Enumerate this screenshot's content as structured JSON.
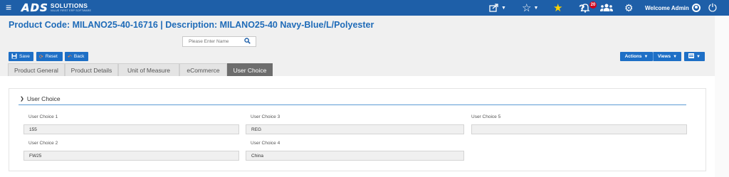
{
  "navbar": {
    "menu_icon": "hamburger-icon",
    "logo": {
      "primary": "ADS",
      "secondary": "SOLUTIONS",
      "tagline": "VALUE FIRST ERP SOFTWARE"
    },
    "icons": [
      "share-icon",
      "star-outline-icon",
      "star-filled-icon",
      "help-icon",
      "bell-icon",
      "users-icon",
      "gear-icon",
      "power-icon"
    ],
    "notification_count": "20",
    "welcome_text": "Welcome Admin",
    "accent_color": "#1e5fa8"
  },
  "page": {
    "title": "Product Code:  MILANO25-40-16716 | Description: MILANO25-40 Navy-Blue/L/Polyester"
  },
  "search": {
    "placeholder": "Please Enter Name"
  },
  "toolbar": {
    "save_label": "Save",
    "reset_label": "Reset",
    "back_label": "Back",
    "actions_label": "Actions",
    "views_label": "Views"
  },
  "tabs": [
    {
      "label": "Product General",
      "active": false
    },
    {
      "label": "Product Details",
      "active": false
    },
    {
      "label": "Unit of Measure",
      "active": false
    },
    {
      "label": "eCommerce",
      "active": false
    },
    {
      "label": "User Choice",
      "active": true
    }
  ],
  "section": {
    "title": "User Choice"
  },
  "fields": {
    "user_choice_1": {
      "label": "User Choice 1",
      "value": "155"
    },
    "user_choice_2": {
      "label": "User Choice 2",
      "value": "FW25"
    },
    "user_choice_3": {
      "label": "User Choice 3",
      "value": "REG"
    },
    "user_choice_4": {
      "label": "User Choice 4",
      "value": "China"
    },
    "user_choice_5": {
      "label": "User Choice 5",
      "value": ""
    }
  }
}
